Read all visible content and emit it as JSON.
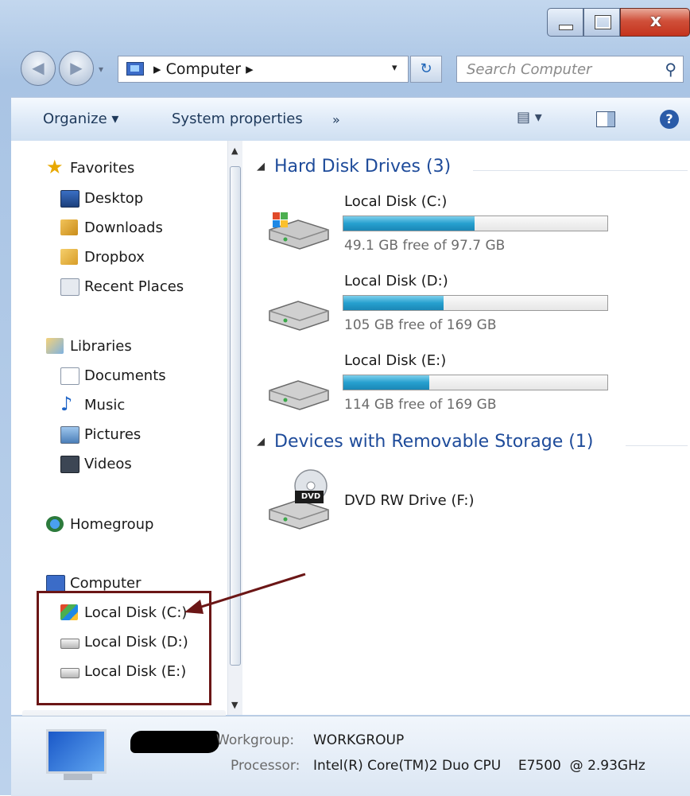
{
  "window": {
    "caption_close": "x"
  },
  "address_bar": {
    "path": "▸ Computer ▸",
    "dropdown": "▾",
    "refresh": "↻",
    "search_placeholder": "Search Computer"
  },
  "toolbar": {
    "organize": "Organize ▾",
    "system_properties": "System properties",
    "more": "»",
    "views": "▤ ▾",
    "help": "?"
  },
  "sidebar": {
    "favorites": {
      "label": "Favorites",
      "items": [
        {
          "label": "Desktop",
          "icon": "desktop-icon"
        },
        {
          "label": "Downloads",
          "icon": "downloads-icon"
        },
        {
          "label": "Dropbox",
          "icon": "dropbox-icon"
        },
        {
          "label": "Recent Places",
          "icon": "recent-places-icon"
        }
      ]
    },
    "libraries": {
      "label": "Libraries",
      "items": [
        {
          "label": "Documents",
          "icon": "documents-icon"
        },
        {
          "label": "Music",
          "icon": "music-icon"
        },
        {
          "label": "Pictures",
          "icon": "pictures-icon"
        },
        {
          "label": "Videos",
          "icon": "videos-icon"
        }
      ]
    },
    "homegroup": "Homegroup",
    "computer": {
      "label": "Computer",
      "items": [
        {
          "label": "Local Disk (C:)",
          "icon": "windows-drive-icon"
        },
        {
          "label": "Local Disk (D:)",
          "icon": "drive-icon"
        },
        {
          "label": "Local Disk (E:)",
          "icon": "drive-icon"
        }
      ]
    }
  },
  "content": {
    "hard_disks": {
      "header": "Hard Disk Drives (3)",
      "drives": [
        {
          "name": "Local Disk (C:)",
          "free": "49.1 GB free of 97.7 GB",
          "used_fraction": 0.497
        },
        {
          "name": "Local Disk (D:)",
          "free": "105 GB free of 169 GB",
          "used_fraction": 0.379
        },
        {
          "name": "Local Disk (E:)",
          "free": "114 GB free of 169 GB",
          "used_fraction": 0.325
        }
      ]
    },
    "removable": {
      "header": "Devices with Removable Storage (1)",
      "devices": [
        {
          "name": "DVD RW Drive (F:)",
          "badge": "DVD"
        }
      ]
    }
  },
  "details": {
    "workgroup_label": "Workgroup:",
    "workgroup_value": "WORKGROUP",
    "processor_label": "Processor:",
    "processor_value": "Intel(R) Core(TM)2 Duo CPU    E7500  @ 2.93GHz"
  },
  "colors": {
    "bar_fill": "#26a0cf",
    "annotation": "#6b1616",
    "group_header": "#1e4b9a"
  }
}
